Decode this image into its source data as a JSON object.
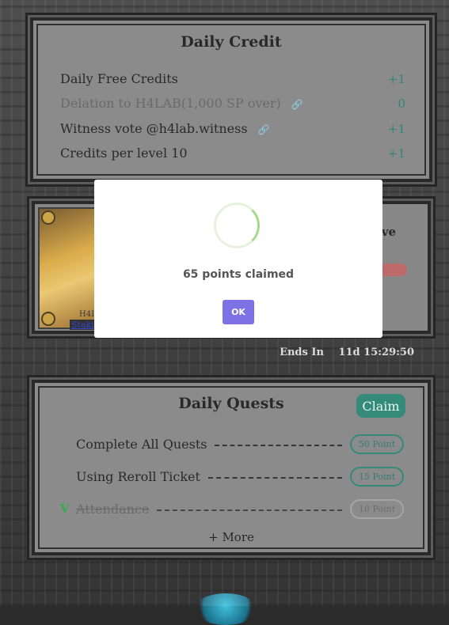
{
  "daily_credit": {
    "title": "Daily Credit",
    "rows": [
      {
        "label": "Daily Free Credits",
        "value": "+1",
        "has_link": false,
        "muted": false
      },
      {
        "label": "Delation to H4LAB(1,000 SP over)",
        "value": "0",
        "has_link": true,
        "muted": true
      },
      {
        "label": "Witness vote @h4lab.witness",
        "value": "+1",
        "has_link": true,
        "muted": false
      },
      {
        "label": "Credits per level 10",
        "value": "+1",
        "has_link": false,
        "muted": false
      }
    ]
  },
  "staking": {
    "card_caption": "H4L",
    "link_label": "Stakin",
    "header_fragment": "ve"
  },
  "ends_in": {
    "label": "Ends In",
    "value": "11d 15:29:50"
  },
  "daily_quests": {
    "title": "Daily Quests",
    "claim_label": "Claim",
    "quests": [
      {
        "label": "Complete All Quests",
        "points": "50 Point",
        "done": false
      },
      {
        "label": "Using Reroll Ticket",
        "points": "15 Point",
        "done": false
      },
      {
        "label": "Attendance",
        "points": "10 Point",
        "done": true,
        "check": "V"
      }
    ],
    "more_label": "+ More"
  },
  "modal": {
    "message": "65 points claimed",
    "ok_label": "OK"
  },
  "colors": {
    "accent_green": "#1e7e6a",
    "ok_button": "#7c72e6",
    "check_green": "#1aa33a"
  }
}
